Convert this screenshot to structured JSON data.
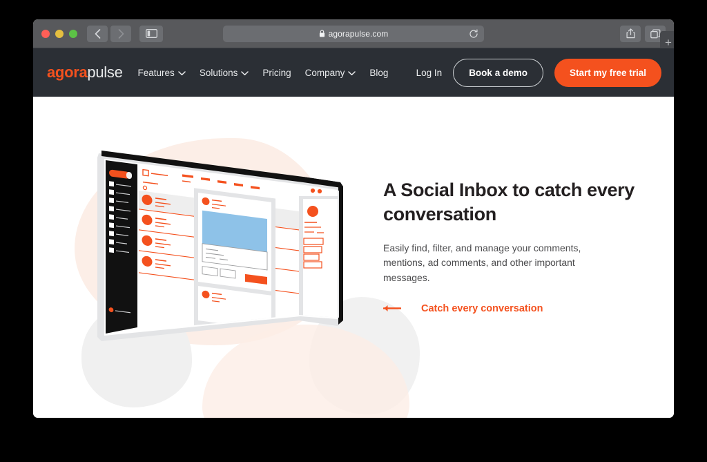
{
  "browser": {
    "url": "agorapulse.com",
    "lock_icon": "lock-icon",
    "reload_icon": "reload-icon",
    "back_icon": "back-chevron-icon",
    "forward_icon": "forward-chevron-icon",
    "sidebar_icon": "sidebar-toggle-icon",
    "share_icon": "share-icon",
    "tabs_icon": "show-tabs-icon",
    "new_tab_label": "+",
    "traffic_lights": [
      "close",
      "minimize",
      "zoom"
    ]
  },
  "site_header": {
    "logo": {
      "part1": "agora",
      "part2": "pulse"
    },
    "nav_items": [
      {
        "label": "Features",
        "has_chevron": true
      },
      {
        "label": "Solutions",
        "has_chevron": true
      },
      {
        "label": "Pricing",
        "has_chevron": false
      },
      {
        "label": "Company",
        "has_chevron": true
      },
      {
        "label": "Blog",
        "has_chevron": false
      }
    ],
    "login_label": "Log In",
    "demo_label": "Book a demo",
    "trial_label": "Start my free trial"
  },
  "hero": {
    "title": "A Social Inbox to catch every conversation",
    "subtitle": "Easily find, filter, and manage your comments, mentions, ad comments, and other important messages.",
    "cta_label": "Catch every conversation",
    "cta_arrow_icon": "arrow-left-icon",
    "illustration_name": "social-inbox-app-mockup",
    "marker_blue_icon": "triangle-left-blue-icon",
    "marker_orange_icon": "triangle-left-orange-icon"
  },
  "colors": {
    "accent_orange": "#f4511e",
    "header_dark": "#2b2f35",
    "toolbar_gray": "#58595c",
    "blob_peach": "#fcebe3",
    "blob_gray": "#f0f0f0",
    "illustration_blue": "#8ec2e8",
    "text_dark": "#231f20",
    "text_body": "#4b4b4d"
  }
}
